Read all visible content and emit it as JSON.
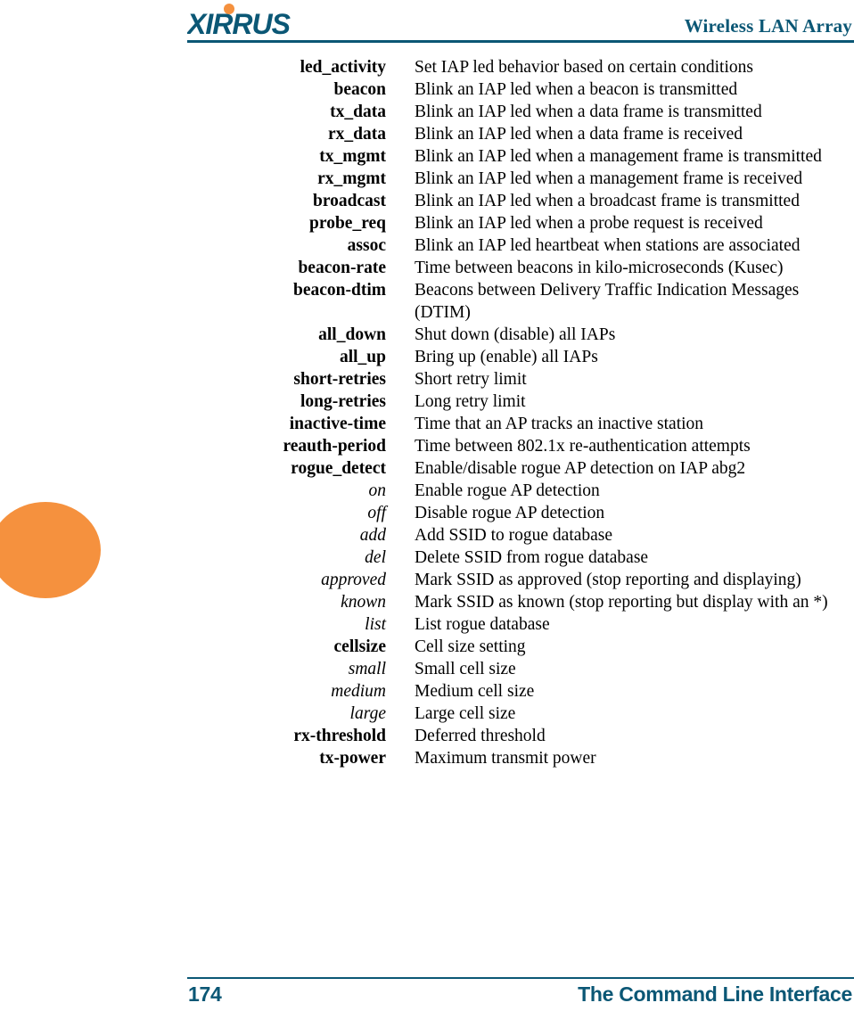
{
  "header": {
    "logo_text": "XIRRUS",
    "logo_icon": "xirrus-logo",
    "title": "Wireless LAN Array",
    "brand_color": "#0B5775",
    "accent_color": "#F5913E"
  },
  "margin_decoration": {
    "shape": "circle",
    "color": "#F5913E"
  },
  "command_list": [
    {
      "term": "led_activity",
      "style": "bold",
      "desc": "Set IAP led behavior based on certain conditions"
    },
    {
      "term": "beacon",
      "style": "bold",
      "desc": "Blink an IAP led when a beacon is transmitted"
    },
    {
      "term": "tx_data",
      "style": "bold",
      "desc": "Blink an IAP led when a data frame is transmitted"
    },
    {
      "term": "rx_data",
      "style": "bold",
      "desc": "Blink an IAP led when a data frame is received"
    },
    {
      "term": "tx_mgmt",
      "style": "bold",
      "desc": "Blink an IAP led when a management frame is transmitted"
    },
    {
      "term": "rx_mgmt",
      "style": "bold",
      "desc": "Blink an IAP led when a management frame is received"
    },
    {
      "term": "broadcast",
      "style": "bold",
      "desc": "Blink an IAP led when a broadcast frame is transmitted"
    },
    {
      "term": "probe_req",
      "style": "bold",
      "desc": "Blink an IAP led when a probe request is received"
    },
    {
      "term": "assoc",
      "style": "bold",
      "desc": "Blink an IAP led heartbeat when stations are associated"
    },
    {
      "term": "beacon-rate",
      "style": "bold",
      "desc": "Time between beacons in kilo-microseconds (Kusec)"
    },
    {
      "term": "beacon-dtim",
      "style": "bold",
      "desc": "Beacons between Delivery Traffic Indication Messages (DTIM)"
    },
    {
      "term": "all_down",
      "style": "bold",
      "desc": "Shut down (disable) all IAPs"
    },
    {
      "term": "all_up",
      "style": "bold",
      "desc": "Bring up (enable) all IAPs"
    },
    {
      "term": "short-retries",
      "style": "bold",
      "desc": "Short retry limit"
    },
    {
      "term": "long-retries",
      "style": "bold",
      "desc": "Long retry limit"
    },
    {
      "term": "inactive-time",
      "style": "bold",
      "desc": "Time that an AP tracks an inactive station"
    },
    {
      "term": "reauth-period",
      "style": "bold",
      "desc": "Time between 802.1x re-authentication attempts"
    },
    {
      "term": "rogue_detect",
      "style": "bold",
      "desc": "Enable/disable rogue AP detection on IAP abg2"
    },
    {
      "term": "on",
      "style": "italic",
      "desc": "Enable rogue AP detection"
    },
    {
      "term": "off",
      "style": "italic",
      "desc": "Disable rogue AP detection"
    },
    {
      "term": "add",
      "style": "italic",
      "desc": "Add SSID to rogue database"
    },
    {
      "term": "del",
      "style": "italic",
      "desc": "Delete SSID from rogue database"
    },
    {
      "term": "approved",
      "style": "italic",
      "desc": "Mark SSID as approved (stop reporting and displaying)"
    },
    {
      "term": "known",
      "style": "italic",
      "desc": "Mark SSID as known (stop reporting but display with an *)"
    },
    {
      "term": "list",
      "style": "italic",
      "desc": "List rogue database"
    },
    {
      "term": "cellsize",
      "style": "bold",
      "desc": "Cell size setting"
    },
    {
      "term": "small",
      "style": "italic",
      "desc": "Small cell size"
    },
    {
      "term": "medium",
      "style": "italic",
      "desc": "Medium cell size"
    },
    {
      "term": "large",
      "style": "italic",
      "desc": "Large cell size"
    },
    {
      "term": "rx-threshold",
      "style": "bold",
      "desc": "Deferred threshold"
    },
    {
      "term": "tx-power",
      "style": "bold",
      "desc": "Maximum transmit power"
    }
  ],
  "footer": {
    "page_number": "174",
    "section_title": "The Command Line Interface"
  }
}
